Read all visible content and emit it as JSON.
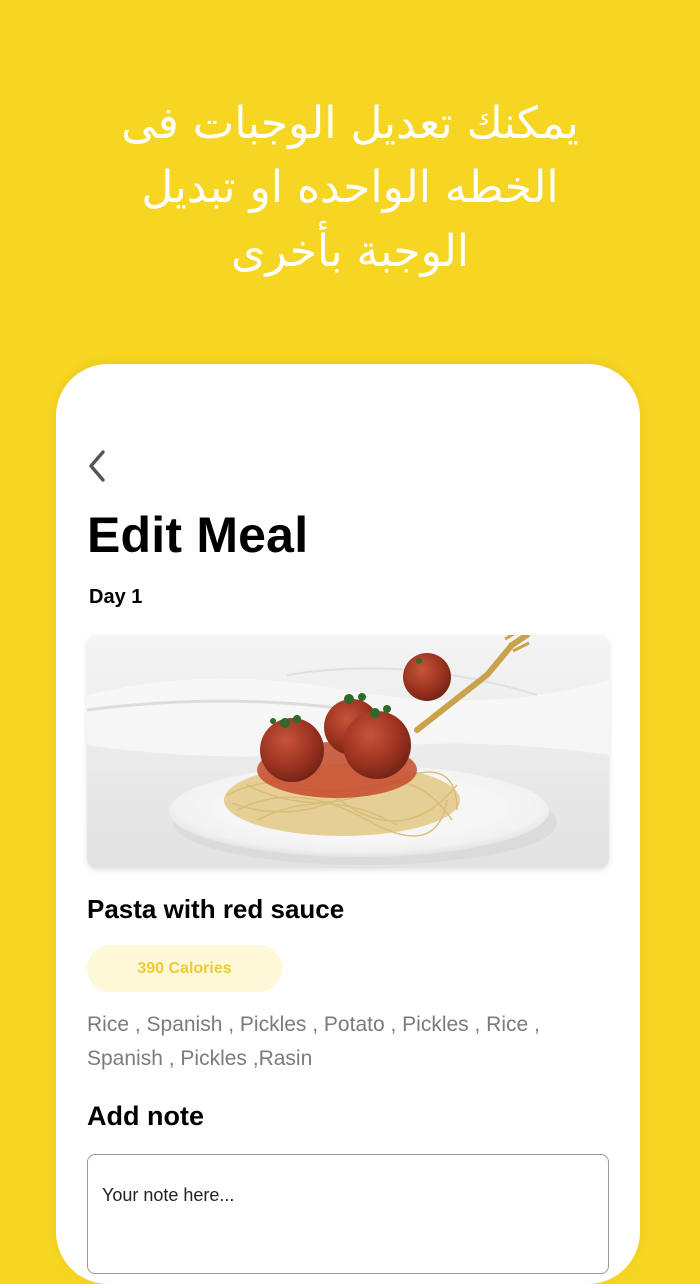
{
  "promo": {
    "line1": "يمكنك تعديل الوجبات فى",
    "line2": "الخطه الواحده او تبديل",
    "line3": "الوجبة بأخرى"
  },
  "screen": {
    "title": "Edit Meal",
    "day": "Day 1"
  },
  "meal": {
    "name": "Pasta with red sauce",
    "calories": "390 Calories",
    "ingredients_line1": "Rice , Spanish , Pickles , Potato , Pickles , Rice ,",
    "ingredients_line2": "Spanish , Pickles ,Rasin"
  },
  "note": {
    "label": "Add note",
    "placeholder": "Your note here..."
  },
  "colors": {
    "background": "#F6D523",
    "calories_pill": "#FEF8D6",
    "calories_text": "#EDCB34"
  }
}
